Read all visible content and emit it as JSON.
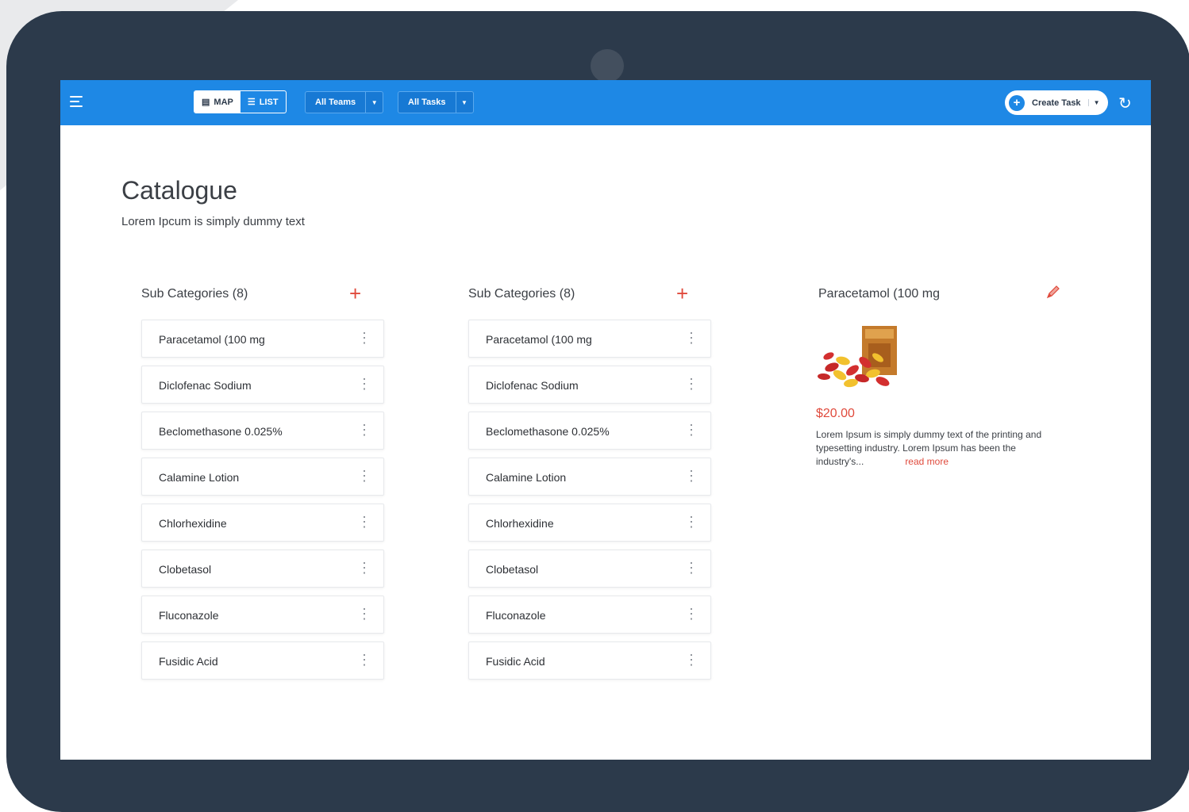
{
  "topbar": {
    "view_toggle": {
      "map_label": "MAP",
      "list_label": "LIST",
      "active": "map"
    },
    "teams_dropdown": "All Teams",
    "tasks_dropdown": "All Tasks",
    "create_task_label": "Create Task"
  },
  "page": {
    "title": "Catalogue",
    "subtitle": "Lorem Ipcum is simply dummy text"
  },
  "columns": [
    {
      "title": "Sub Categories (8)",
      "items": [
        "Paracetamol (100 mg",
        "Diclofenac Sodium",
        "Beclomethasone 0.025%",
        "Calamine Lotion",
        "Chlorhexidine",
        "Clobetasol",
        "Fluconazole",
        "Fusidic Acid"
      ]
    },
    {
      "title": "Sub Categories (8)",
      "items": [
        "Paracetamol (100 mg",
        "Diclofenac Sodium",
        "Beclomethasone 0.025%",
        "Calamine Lotion",
        "Chlorhexidine",
        "Clobetasol",
        "Fluconazole",
        "Fusidic Acid"
      ]
    }
  ],
  "detail": {
    "title": "Paracetamol (100 mg",
    "price": "$20.00",
    "description": "Lorem Ipsum is simply dummy text of the printing and typesetting industry. Lorem Ipsum has been the industry's...",
    "read_more": "read more"
  },
  "colors": {
    "topbar": "#1e88e5",
    "accent_red": "#e04a3c",
    "device_frame": "#2c3a4b"
  },
  "icons": {
    "menu": "hamburger-menu-icon",
    "map": "map-icon",
    "list": "list-icon",
    "add": "plus-icon",
    "more": "vertical-dots-icon",
    "edit": "pencil-icon",
    "refresh": "refresh-icon"
  }
}
